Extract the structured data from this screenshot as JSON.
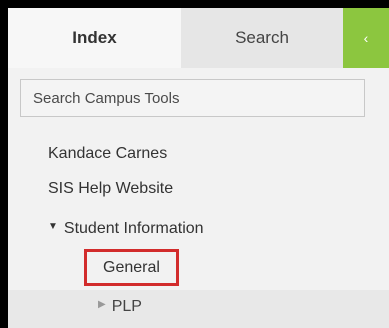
{
  "tabs": {
    "index_label": "Index",
    "search_label": "Search",
    "collapse_glyph": "‹"
  },
  "search": {
    "placeholder": "Search Campus Tools"
  },
  "tree": {
    "user_name": "Kandace Carnes",
    "help_link": "SIS Help Website",
    "folder_label": "Student Information",
    "folder_expanded_glyph": "▼",
    "selected_item": "General",
    "child_collapsed_glyph": "▶",
    "child_item": "PLP"
  },
  "colors": {
    "accent_green": "#8cc63f",
    "highlight_red": "#d22c2c"
  }
}
